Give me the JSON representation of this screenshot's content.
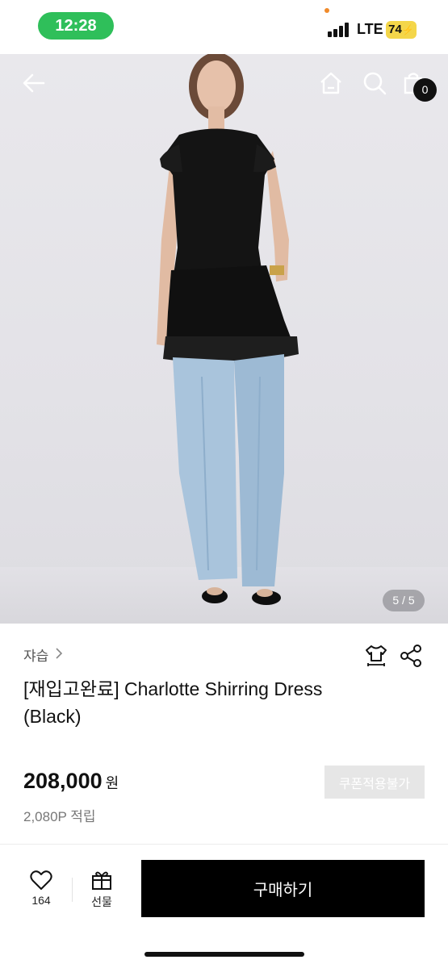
{
  "status_bar": {
    "time": "12:28",
    "network": "LTE",
    "battery": "74",
    "time_pill_color": "#2fbf5a",
    "battery_color": "#f4d64a"
  },
  "header": {
    "back_icon": "arrow-left-icon",
    "home_icon": "home-icon",
    "search_icon": "search-icon",
    "cart_icon": "shopping-bag-icon",
    "cart_count": "0"
  },
  "gallery": {
    "page_indicator": "5 / 5"
  },
  "product": {
    "brand": "쟈습",
    "title": "[재입고완료] Charlotte Shirring Dress (Black)",
    "price": "208,000",
    "currency": "원",
    "points": "2,080P 적립",
    "coupon_label": "쿠폰적용불가",
    "size_icon": "shirt-size-icon",
    "share_icon": "share-icon"
  },
  "bottom_bar": {
    "like_count": "164",
    "gift_label": "선물",
    "buy_label": "구매하기"
  }
}
